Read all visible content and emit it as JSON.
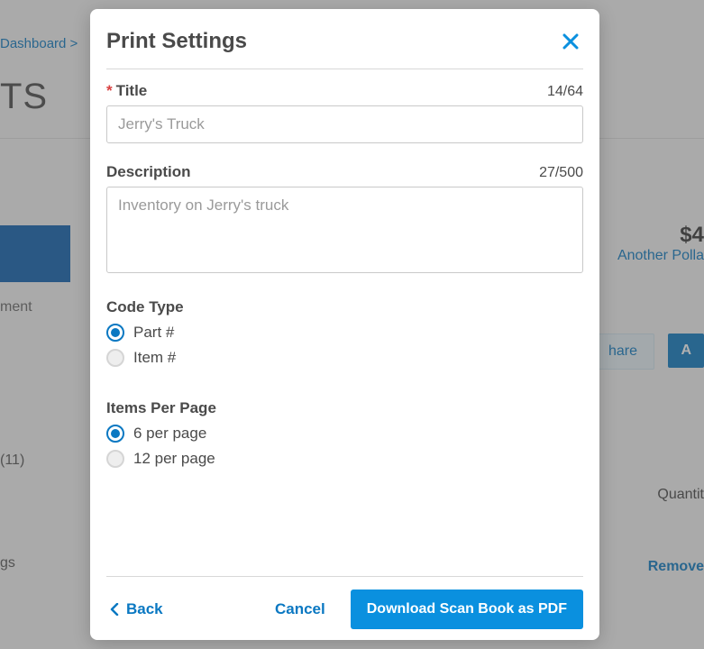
{
  "background": {
    "breadcrumb": "Dashboard  >",
    "title_fragment": "TS",
    "nav_item": "ment",
    "count_label": "(11)",
    "nav_item2": "gs",
    "price_fragment": "$4",
    "link_fragment": "Another Polla",
    "share_label": "hare",
    "add_label": "A",
    "quantity_label": "Quantit",
    "remove_label": "Remove"
  },
  "modal": {
    "title": "Print Settings",
    "title_field": {
      "label": "Title",
      "value": "Jerry's Truck",
      "counter": "14/64"
    },
    "description_field": {
      "label": "Description",
      "value": "Inventory on Jerry's truck",
      "counter": "27/500"
    },
    "code_type": {
      "label": "Code Type",
      "options": [
        {
          "label": "Part #",
          "selected": true
        },
        {
          "label": "Item #",
          "selected": false
        }
      ]
    },
    "items_per_page": {
      "label": "Items Per Page",
      "options": [
        {
          "label": "6 per page",
          "selected": true
        },
        {
          "label": "12 per page",
          "selected": false
        }
      ]
    },
    "footer": {
      "back": "Back",
      "cancel": "Cancel",
      "download": "Download Scan Book as PDF"
    }
  }
}
